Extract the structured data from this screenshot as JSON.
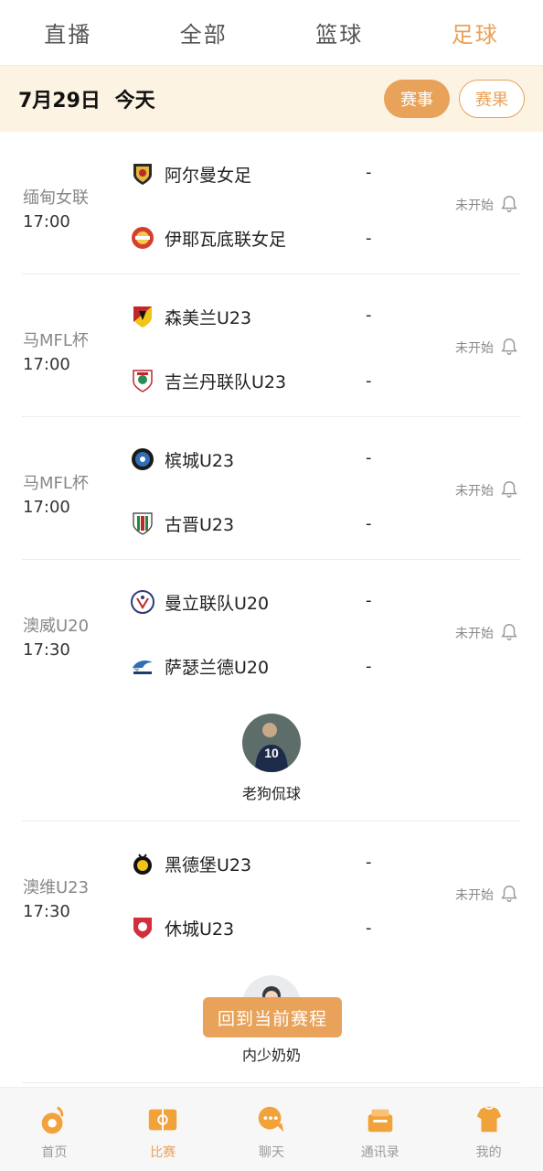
{
  "top_tabs": [
    "直播",
    "全部",
    "篮球",
    "足球"
  ],
  "active_tab": "足球",
  "date_bar": {
    "date": "7月29日",
    "today": "今天",
    "btn_schedule": "赛事",
    "btn_results": "赛果"
  },
  "matches": [
    {
      "league": "缅甸女联",
      "time": "17:00",
      "home": "阿尔曼女足",
      "away": "伊耶瓦底联女足",
      "home_score": "-",
      "away_score": "-",
      "status": "未开始"
    },
    {
      "league": "马MFL杯",
      "time": "17:00",
      "home": "森美兰U23",
      "away": "吉兰丹联队U23",
      "home_score": "-",
      "away_score": "-",
      "status": "未开始"
    },
    {
      "league": "马MFL杯",
      "time": "17:00",
      "home": "槟城U23",
      "away": "古晋U23",
      "home_score": "-",
      "away_score": "-",
      "status": "未开始"
    },
    {
      "league": "澳威U20",
      "time": "17:30",
      "home": "曼立联队U20",
      "away": "萨瑟兰德U20",
      "home_score": "-",
      "away_score": "-",
      "status": "未开始",
      "promoter": "老狗侃球"
    },
    {
      "league": "澳维U23",
      "time": "17:30",
      "home": "黑德堡U23",
      "away": "休城U23",
      "home_score": "-",
      "away_score": "-",
      "status": "未开始",
      "promoter": "内少奶奶"
    }
  ],
  "back_button": "回到当前赛程",
  "avatar_text": "10",
  "bottom_nav": [
    {
      "label": "首页",
      "icon": "home-icon"
    },
    {
      "label": "比赛",
      "icon": "match-icon"
    },
    {
      "label": "聊天",
      "icon": "chat-icon"
    },
    {
      "label": "通讯录",
      "icon": "contacts-icon"
    },
    {
      "label": "我的",
      "icon": "profile-icon"
    }
  ],
  "active_nav": "比赛",
  "colors": {
    "accent": "#e8a25a",
    "date_bar_bg": "#fdf3e3",
    "divider": "#e8eef0"
  }
}
